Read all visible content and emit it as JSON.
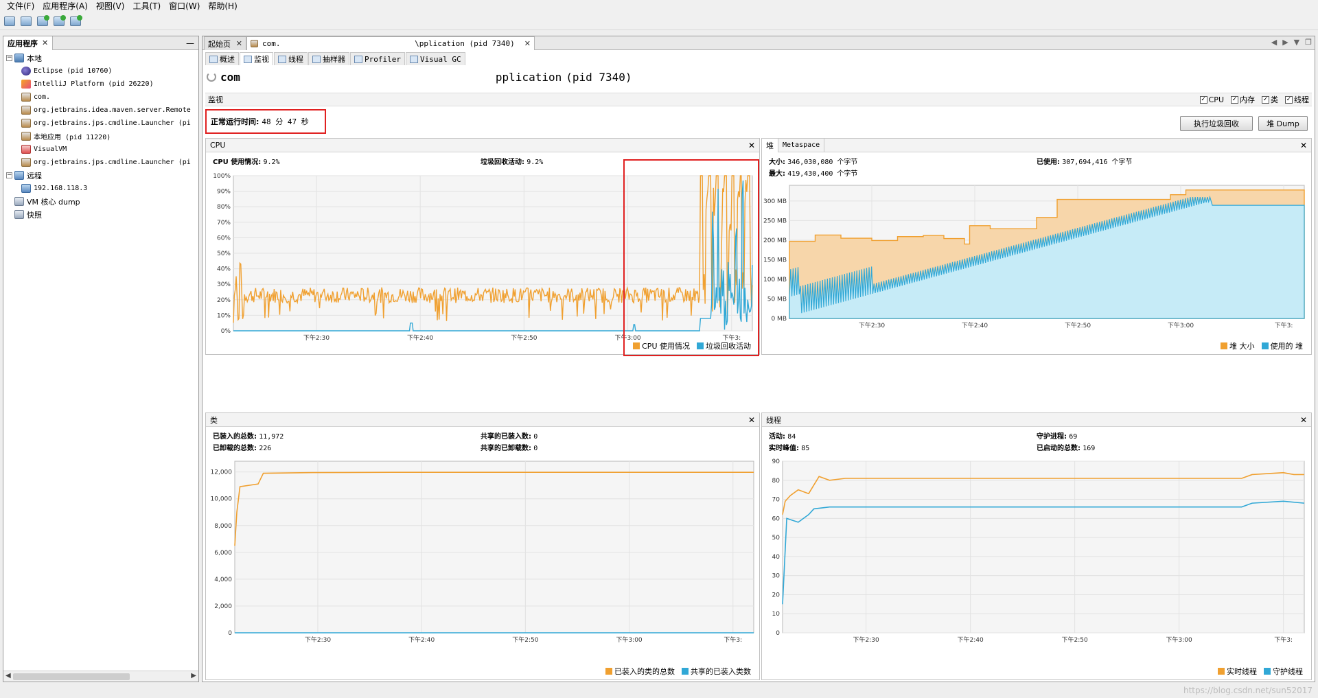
{
  "menu": [
    "文件(F)",
    "应用程序(A)",
    "视图(V)",
    "工具(T)",
    "窗口(W)",
    "帮助(H)"
  ],
  "toolbar_icons": [
    "add-jmx-icon",
    "add-remote-host-icon",
    "add-jmx-connection-icon",
    "add-core-dump-icon",
    "add-snapshot-icon"
  ],
  "left": {
    "tab": "应用程序",
    "nodes": [
      {
        "label": "本地",
        "icon": "host-icon",
        "level": 0,
        "expander": "−"
      },
      {
        "label": "Eclipse (pid 10760)",
        "icon": "eclipse-icon",
        "level": 1
      },
      {
        "label": "IntelliJ Platform (pid 26220)",
        "icon": "intellij-icon",
        "level": 1
      },
      {
        "label": "com.",
        "icon": "java-icon",
        "level": 1
      },
      {
        "label": "org.jetbrains.idea.maven.server.Remote",
        "icon": "java-icon",
        "level": 1
      },
      {
        "label": "org.jetbrains.jps.cmdline.Launcher (pi",
        "icon": "java-icon",
        "level": 1
      },
      {
        "label": "本地应用 (pid 11220)",
        "icon": "java-icon",
        "level": 1
      },
      {
        "label": "VisualVM",
        "icon": "visualvm-icon",
        "level": 1
      },
      {
        "label": "org.jetbrains.jps.cmdline.Launcher (pi",
        "icon": "java-icon",
        "level": 1
      },
      {
        "label": "远程",
        "icon": "remote-icon",
        "level": 0,
        "expander": "−"
      },
      {
        "label": "192.168.118.3",
        "icon": "remote-host-icon",
        "level": 1
      },
      {
        "label": "VM 核心 dump",
        "icon": "core-dump-icon",
        "level": 0
      },
      {
        "label": "快照",
        "icon": "snapshot-icon",
        "level": 0
      }
    ]
  },
  "doc_tabs": [
    {
      "label": "起始页",
      "active": false
    },
    {
      "label": "com.",
      "suffix": "\\pplication (pid 7340)",
      "active": true
    }
  ],
  "sub_tabs": [
    {
      "label": "概述",
      "active": false
    },
    {
      "label": "监视",
      "active": true
    },
    {
      "label": "线程",
      "active": false
    },
    {
      "label": "抽样器",
      "active": false
    },
    {
      "label": "Profiler",
      "active": false
    },
    {
      "label": "Visual GC",
      "active": false
    }
  ],
  "app_title": {
    "prefix": "com",
    "suffix": "pplication",
    "pid": "(pid 7340)"
  },
  "section": {
    "label": "监视",
    "checks": [
      {
        "label": "CPU",
        "checked": true
      },
      {
        "label": "内存",
        "checked": true
      },
      {
        "label": "类",
        "checked": true
      },
      {
        "label": "线程",
        "checked": true
      }
    ]
  },
  "uptime": {
    "label": "正常运行时间:",
    "value": "48 分 47 秒"
  },
  "buttons": {
    "gc": "执行垃圾回收",
    "dump": "堆 Dump"
  },
  "cpu": {
    "title": "CPU",
    "usage_label": "CPU 使用情况:",
    "usage_value": "9.2%",
    "gc_label": "垃圾回收活动:",
    "gc_value": "9.2%",
    "legend": [
      "CPU 使用情况",
      "垃圾回收活动"
    ]
  },
  "heap": {
    "tabs": [
      "堆",
      "Metaspace"
    ],
    "size_label": "大小:",
    "size_value": "346,030,080 个字节",
    "max_label": "最大:",
    "max_value": "419,430,400 个字节",
    "used_label": "已使用:",
    "used_value": "307,694,416 个字节",
    "legend": [
      "堆 大小",
      "使用的 堆"
    ]
  },
  "classes": {
    "title": "类",
    "loaded_label": "已装入的总数:",
    "loaded_value": "11,972",
    "unloaded_label": "已卸载的总数:",
    "unloaded_value": "226",
    "shared_loaded_label": "共享的已装入数:",
    "shared_loaded_value": "0",
    "shared_unloaded_label": "共享的已卸载数:",
    "shared_unloaded_value": "0",
    "legend": [
      "已装入的类的总数",
      "共享的已装入类数"
    ]
  },
  "threads": {
    "title": "线程",
    "live_label": "活动:",
    "live_value": "84",
    "peak_label": "实时峰值:",
    "peak_value": "85",
    "daemon_label": "守护进程:",
    "daemon_value": "69",
    "started_label": "已启动的总数:",
    "started_value": "169",
    "legend": [
      "实时线程",
      "守护线程"
    ]
  },
  "colors": {
    "orange": "#f0a030",
    "blue": "#31a8d6",
    "red": "#e02020"
  },
  "chart_data": [
    {
      "type": "line",
      "name": "cpu",
      "x_ticks": [
        "下午2:30",
        "下午2:40",
        "下午2:50",
        "下午3:00",
        "下午3:"
      ],
      "y_ticks": [
        "0%",
        "10%",
        "20%",
        "30%",
        "40%",
        "50%",
        "60%",
        "70%",
        "80%",
        "90%",
        "100%"
      ],
      "ylim": [
        0,
        100
      ],
      "series": [
        {
          "name": "CPU 使用情况",
          "level": 23,
          "noise": 5,
          "burst_start": 0.9
        },
        {
          "name": "垃圾回收活动",
          "level": 0,
          "burst_start": 0.9
        }
      ]
    },
    {
      "type": "area",
      "name": "heap",
      "x_ticks": [
        "下午2:30",
        "下午2:40",
        "下午2:50",
        "下午3:00",
        "下午3:"
      ],
      "y_ticks": [
        "0 MB",
        "50 MB",
        "100 MB",
        "150 MB",
        "200 MB",
        "250 MB",
        "300 MB"
      ],
      "ylim": [
        0,
        340
      ],
      "series": [
        {
          "name": "堆 大小",
          "steps": [
            [
              0,
              197
            ],
            [
              0.05,
              213
            ],
            [
              0.1,
              205
            ],
            [
              0.16,
              199
            ],
            [
              0.21,
              209
            ],
            [
              0.26,
              212
            ],
            [
              0.3,
              204
            ],
            [
              0.34,
              190
            ],
            [
              0.35,
              237
            ],
            [
              0.39,
              229
            ],
            [
              0.48,
              258
            ],
            [
              0.52,
              304
            ],
            [
              0.74,
              316
            ],
            [
              0.77,
              328
            ],
            [
              1,
              328
            ]
          ]
        },
        {
          "name": "使用的 堆",
          "start": 5,
          "end": 300,
          "plateau": 289
        }
      ]
    },
    {
      "type": "line",
      "name": "classes",
      "x_ticks": [
        "下午2:30",
        "下午2:40",
        "下午2:50",
        "下午3:00",
        "下午3:"
      ],
      "y_ticks": [
        "0",
        "2,000",
        "4,000",
        "6,000",
        "8,000",
        "10,000",
        "12,000"
      ],
      "ylim": [
        0,
        12800
      ],
      "series": [
        {
          "name": "已装入的类的总数",
          "points": [
            [
              0,
              6500
            ],
            [
              0.004,
              9000
            ],
            [
              0.01,
              10900
            ],
            [
              0.045,
              11100
            ],
            [
              0.055,
              11900
            ],
            [
              0.15,
              11950
            ],
            [
              0.3,
              11972
            ],
            [
              1,
              11972
            ]
          ]
        },
        {
          "name": "共享的已装入类数",
          "points": [
            [
              0,
              0
            ],
            [
              1,
              0
            ]
          ]
        }
      ]
    },
    {
      "type": "line",
      "name": "threads",
      "x_ticks": [
        "下午2:30",
        "下午2:40",
        "下午2:50",
        "下午3:00",
        "下午3:"
      ],
      "y_ticks": [
        "0",
        "10",
        "20",
        "30",
        "40",
        "50",
        "60",
        "70",
        "80",
        "90"
      ],
      "ylim": [
        0,
        90
      ],
      "series": [
        {
          "name": "实时线程",
          "points": [
            [
              0,
              62
            ],
            [
              0.005,
              69
            ],
            [
              0.015,
              72
            ],
            [
              0.03,
              75
            ],
            [
              0.05,
              73
            ],
            [
              0.07,
              82
            ],
            [
              0.09,
              80
            ],
            [
              0.12,
              81
            ],
            [
              0.18,
              81
            ],
            [
              0.45,
              81
            ],
            [
              0.8,
              81
            ],
            [
              0.88,
              81
            ],
            [
              0.9,
              83
            ],
            [
              0.96,
              84
            ],
            [
              0.98,
              83
            ],
            [
              1,
              83
            ]
          ]
        },
        {
          "name": "守护线程",
          "points": [
            [
              0,
              15
            ],
            [
              0.008,
              60
            ],
            [
              0.03,
              58
            ],
            [
              0.05,
              62
            ],
            [
              0.06,
              65
            ],
            [
              0.09,
              66
            ],
            [
              0.12,
              66
            ],
            [
              0.45,
              66
            ],
            [
              0.88,
              66
            ],
            [
              0.9,
              68
            ],
            [
              0.96,
              69
            ],
            [
              1,
              68
            ]
          ]
        }
      ]
    }
  ],
  "watermark": "https://blog.csdn.net/sun52017"
}
